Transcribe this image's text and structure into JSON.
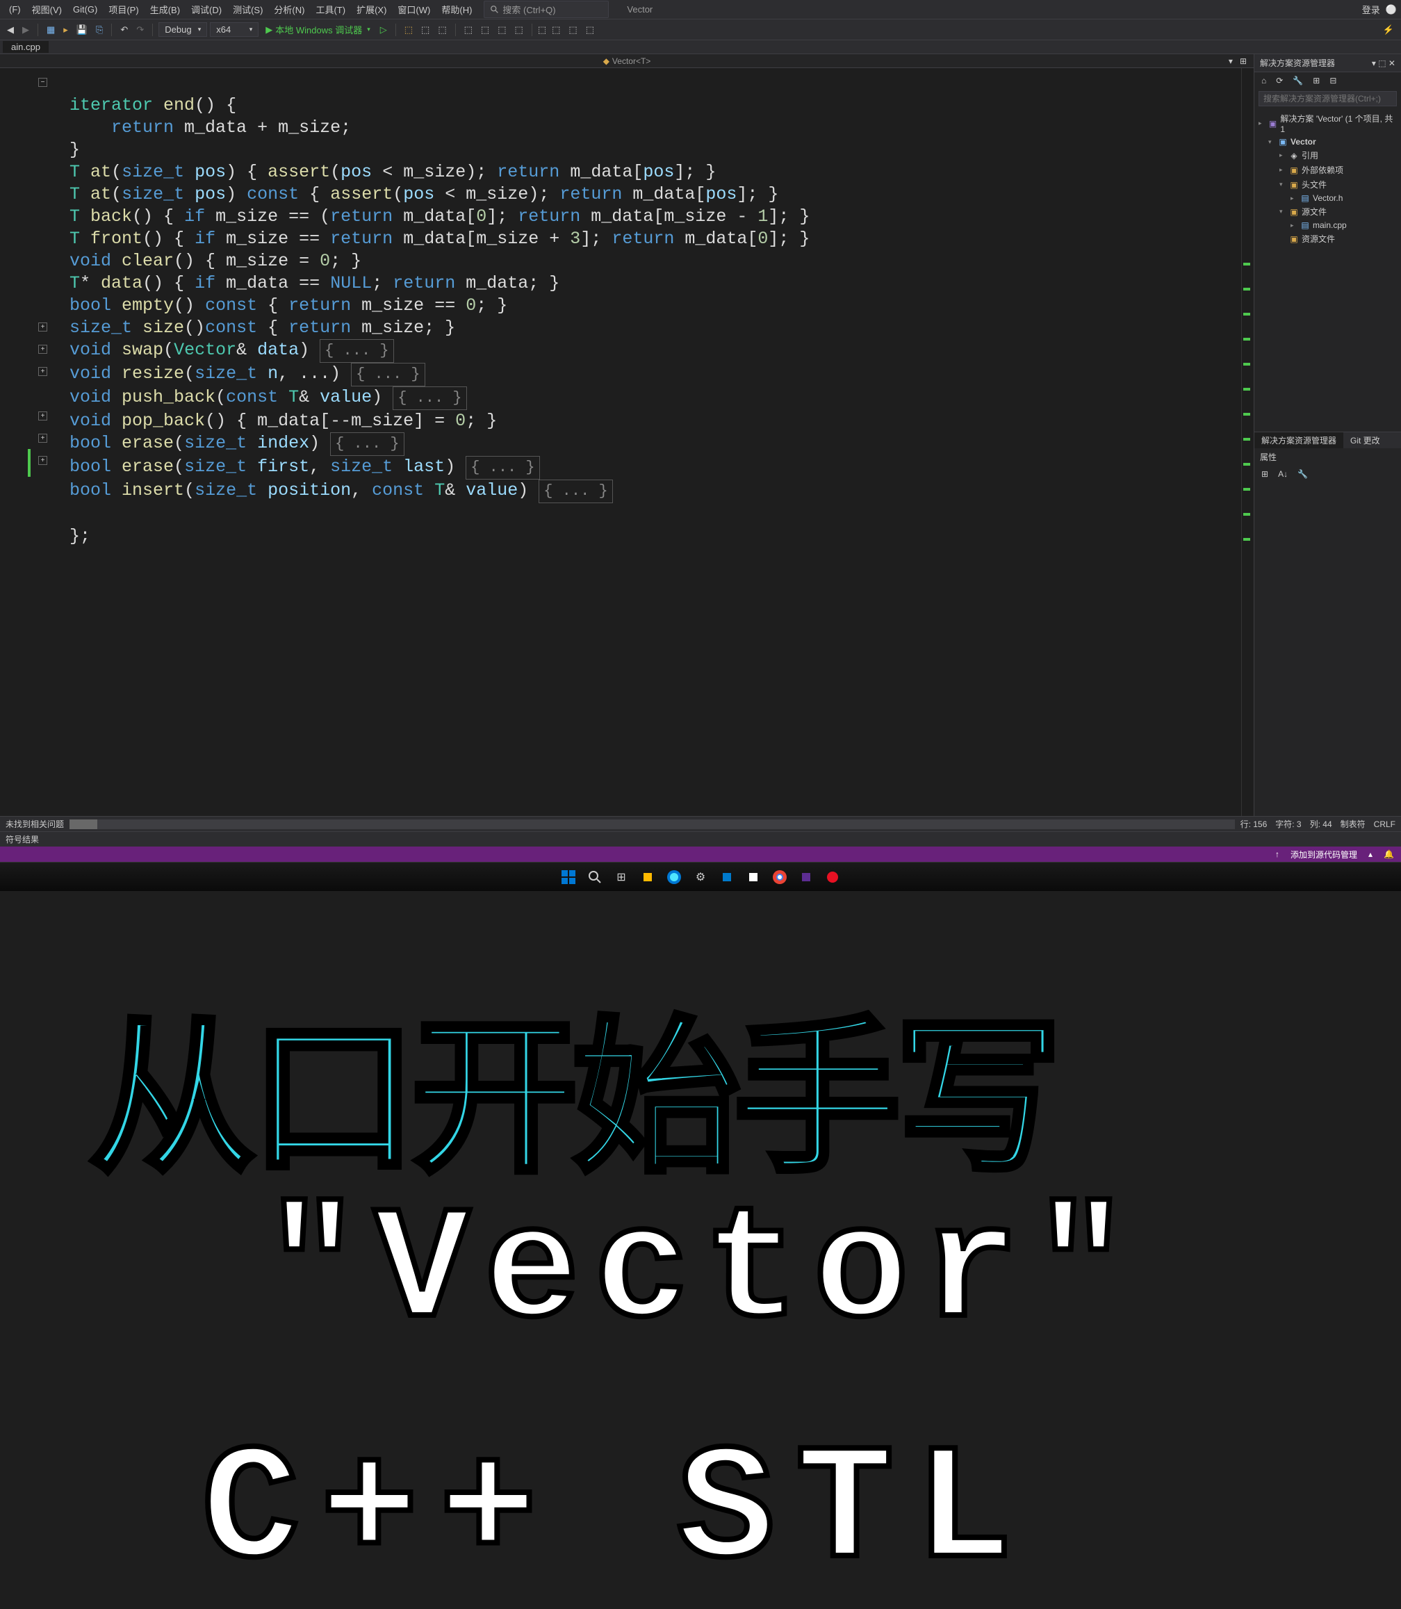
{
  "menu": {
    "items": [
      "(F)",
      "视图(V)",
      "Git(G)",
      "项目(P)",
      "生成(B)",
      "调试(D)",
      "测试(S)",
      "分析(N)",
      "工具(T)",
      "扩展(X)",
      "窗口(W)",
      "帮助(H)"
    ],
    "search_placeholder": "搜索 (Ctrl+Q)",
    "app_title": "Vector",
    "login": "登录"
  },
  "toolbar": {
    "config": "Debug",
    "platform": "x64",
    "debugger": "本地 Windows 调试器"
  },
  "tabs": {
    "file_tab": "ain.cpp"
  },
  "breadcrumb": {
    "label": "Vector<T>"
  },
  "code_lines": [
    "iterator end() {",
    "    return m_data + m_size;",
    "}",
    "T at(size_t pos) { assert(pos < m_size); return m_data[pos]; }",
    "T at(size_t pos) const { assert(pos < m_size); return m_data[pos]; }",
    "T back() { if m_size == 0 return m_data[0]; return m_data[m_size - 1]; }",
    "T front() { if m_size == 0 return m_data[m_size + 3]; return m_data[0]; }",
    "void clear() { m_size = 0; }",
    "T* data() { if m_data == NULL; return m_data; }",
    "bool empty() const { return m_size == 0; }",
    "size_t size()const { return m_size; }",
    "void swap(Vector& data) { ... }",
    "void resize(size_t n, ...) { ... }",
    "void push_back(const T& value) { ... }",
    "void pop_back() { m_data[--m_size] = 0; }",
    "bool erase(size_t index) { ... }",
    "bool erase(size_t first, size_t last) { ... }",
    "bool insert(size_t position, const T& value) { ... }",
    "",
    "};"
  ],
  "solution_explorer": {
    "title": "解决方案资源管理器",
    "search_placeholder": "搜索解决方案资源管理器(Ctrl+;)",
    "solution": "解决方案 'Vector' (1 个项目, 共 1",
    "project": "Vector",
    "refs": "引用",
    "external": "外部依赖项",
    "headers": "头文件",
    "header_file": "Vector.h",
    "sources": "源文件",
    "source_file": "main.cpp",
    "resources": "资源文件"
  },
  "properties": {
    "tab1": "解决方案资源管理器",
    "tab2": "Git 更改",
    "header": "属性"
  },
  "bottom": {
    "no_issues": "未找到相关问题",
    "find_results": "符号结果"
  },
  "status": {
    "line": "行: 156",
    "char": "字符: 3",
    "col": "列: 44",
    "tabs": "制表符",
    "crlf": "CRLF",
    "source_control": "添加到源代码管理",
    "arrow": "↑"
  },
  "overlay": {
    "line1": "从口开始手写",
    "line2": "\"Vector\"",
    "line3": "C++ STL"
  }
}
